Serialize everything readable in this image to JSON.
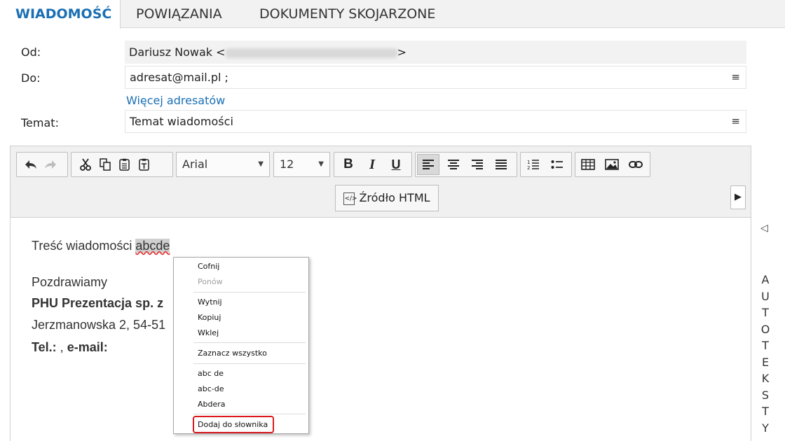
{
  "tabs": {
    "message": "WIADOMOŚĆ",
    "relations": "POWIĄZANIA",
    "documents": "DOKUMENTY SKOJARZONE"
  },
  "form": {
    "from_label": "Od:",
    "from_name": "Dariusz Nowak <",
    "from_end": ">",
    "to_label": "Do:",
    "to_value": "adresat@mail.pl ;",
    "more_recipients": "Więcej adresatów",
    "subject_label": "Temat:",
    "subject_value": "Temat wiadomości",
    "menu_glyph": "≡"
  },
  "toolbar": {
    "font": "Arial",
    "size": "12",
    "bold": "B",
    "italic": "I",
    "underline": "U",
    "source_label": "Źródło HTML",
    "active_align": "left"
  },
  "body": {
    "line1_prefix": "Treść wiadomości ",
    "line1_word": "abcde",
    "greeting": "Pozdrawiamy",
    "company": "PHU Prezentacja sp. z",
    "address": "Jerzmanowska 2, 54-51",
    "contact_tel": "Tel.:",
    "contact_sep": " , ",
    "contact_email": "e-mail:"
  },
  "side_panel": {
    "letters": [
      "A",
      "U",
      "T",
      "O",
      "T",
      "E",
      "K",
      "S",
      "T",
      "Y"
    ]
  },
  "context_menu": {
    "undo": "Cofnij",
    "redo": "Ponów",
    "cut": "Wytnij",
    "copy": "Kopiuj",
    "paste": "Wklej",
    "select_all": "Zaznacz wszystko",
    "suggestions": [
      "abc de",
      "abc-de",
      "Abdera"
    ],
    "add_dictionary": "Dodaj do słownika"
  },
  "colors": {
    "accent": "#1a6fb4",
    "highlight_box": "#d9191f",
    "spell_error": "#e03b3b"
  },
  "icons": [
    "undo-icon",
    "redo-icon",
    "cut-icon",
    "copy-icon",
    "paste-icon",
    "paste-text-icon",
    "align-left-icon",
    "align-center-icon",
    "align-right-icon",
    "align-justify-icon",
    "numbered-list-icon",
    "bullet-list-icon",
    "table-icon",
    "image-icon",
    "link-icon",
    "html-source-icon",
    "expand-right-icon",
    "collapse-left-icon"
  ]
}
